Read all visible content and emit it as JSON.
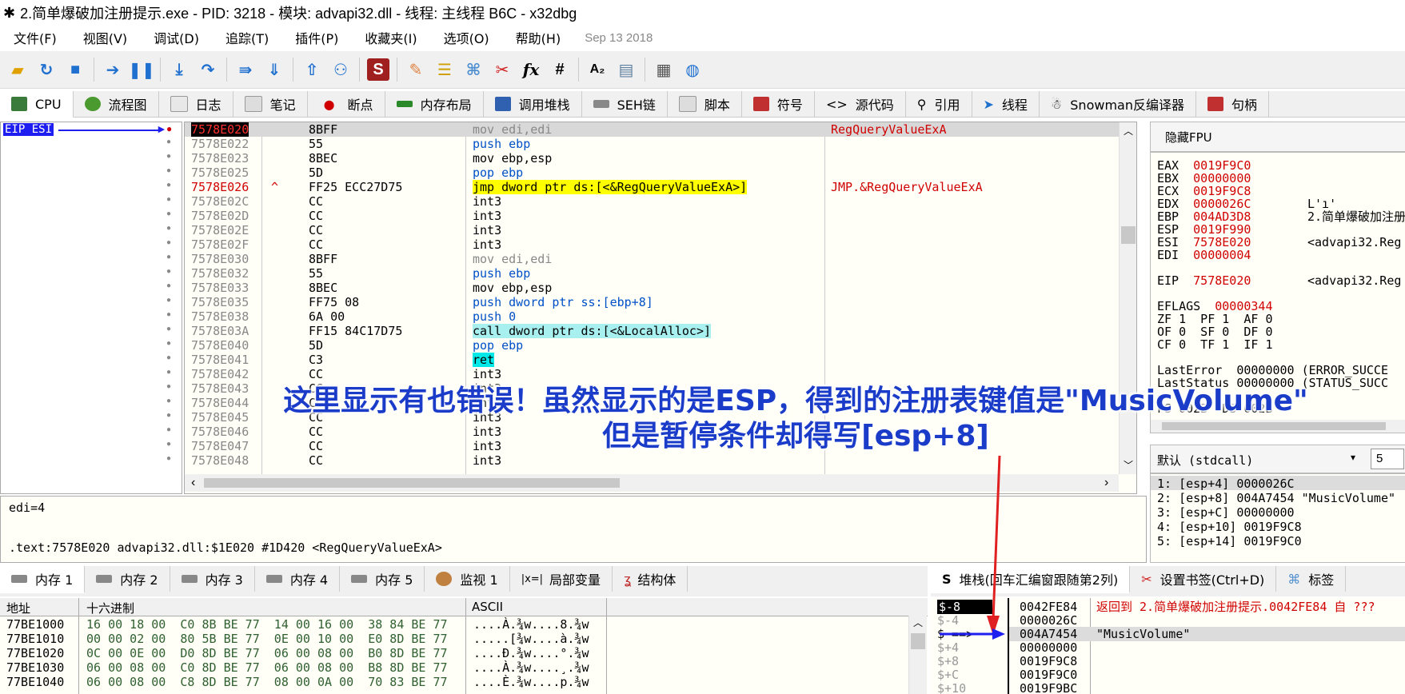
{
  "window": {
    "title": "2.简单爆破加注册提示.exe - PID: 3218 - 模块: advapi32.dll - 线程: 主线程 B6C - x32dbg"
  },
  "menu": {
    "items": [
      "文件(F)",
      "视图(V)",
      "调试(D)",
      "追踪(T)",
      "插件(P)",
      "收藏夹(I)",
      "选项(O)",
      "帮助(H)"
    ],
    "date": "Sep 13 2018"
  },
  "toolbar": {
    "fx_label": "fx",
    "hash_label": "#",
    "az_label": "A₂"
  },
  "tabs": [
    {
      "label": "CPU"
    },
    {
      "label": "流程图"
    },
    {
      "label": "日志"
    },
    {
      "label": "笔记"
    },
    {
      "label": "断点"
    },
    {
      "label": "内存布局"
    },
    {
      "label": "调用堆栈"
    },
    {
      "label": "SEH链"
    },
    {
      "label": "脚本"
    },
    {
      "label": "符号"
    },
    {
      "label": "源代码"
    },
    {
      "label": "引用"
    },
    {
      "label": "线程"
    },
    {
      "label": "Snowman反编译器"
    },
    {
      "label": "句柄"
    }
  ],
  "gutter": {
    "label": "EIP ESI"
  },
  "disasm": {
    "rows": [
      {
        "addr": "7578E020",
        "bytes": "8BFF",
        "ins": "mov edi,edi",
        "cmt": "RegQueryValueExA"
      },
      {
        "addr": "7578E022",
        "bytes": "55",
        "ins": "push ebp",
        "cmt": ""
      },
      {
        "addr": "7578E023",
        "bytes": "8BEC",
        "ins": "mov ebp,esp",
        "cmt": ""
      },
      {
        "addr": "7578E025",
        "bytes": "5D",
        "ins": "pop ebp",
        "cmt": ""
      },
      {
        "addr": "7578E026",
        "bytes": "FF25 ECC27D75",
        "ins": "jmp dword ptr ds:[<&RegQueryValueExA>]",
        "cmt": "JMP.&RegQueryValueExA"
      },
      {
        "addr": "7578E02C",
        "bytes": "CC",
        "ins": "int3",
        "cmt": ""
      },
      {
        "addr": "7578E02D",
        "bytes": "CC",
        "ins": "int3",
        "cmt": ""
      },
      {
        "addr": "7578E02E",
        "bytes": "CC",
        "ins": "int3",
        "cmt": ""
      },
      {
        "addr": "7578E02F",
        "bytes": "CC",
        "ins": "int3",
        "cmt": ""
      },
      {
        "addr": "7578E030",
        "bytes": "8BFF",
        "ins": "mov edi,edi",
        "cmt": ""
      },
      {
        "addr": "7578E032",
        "bytes": "55",
        "ins": "push ebp",
        "cmt": ""
      },
      {
        "addr": "7578E033",
        "bytes": "8BEC",
        "ins": "mov ebp,esp",
        "cmt": ""
      },
      {
        "addr": "7578E035",
        "bytes": "FF75 08",
        "ins": "push dword ptr ss:[ebp+8]",
        "cmt": ""
      },
      {
        "addr": "7578E038",
        "bytes": "6A 00",
        "ins": "push 0",
        "cmt": ""
      },
      {
        "addr": "7578E03A",
        "bytes": "FF15 84C17D75",
        "ins": "call dword ptr ds:[<&LocalAlloc>]",
        "cmt": ""
      },
      {
        "addr": "7578E040",
        "bytes": "5D",
        "ins": "pop ebp",
        "cmt": ""
      },
      {
        "addr": "7578E041",
        "bytes": "C3",
        "ins": "ret",
        "cmt": ""
      },
      {
        "addr": "7578E042",
        "bytes": "CC",
        "ins": "int3",
        "cmt": ""
      },
      {
        "addr": "7578E043",
        "bytes": "CC",
        "ins": "int3",
        "cmt": ""
      },
      {
        "addr": "7578E044",
        "bytes": "CC",
        "ins": "int3",
        "cmt": ""
      },
      {
        "addr": "7578E045",
        "bytes": "CC",
        "ins": "int3",
        "cmt": ""
      },
      {
        "addr": "7578E046",
        "bytes": "CC",
        "ins": "int3",
        "cmt": ""
      },
      {
        "addr": "7578E047",
        "bytes": "CC",
        "ins": "int3",
        "cmt": ""
      },
      {
        "addr": "7578E048",
        "bytes": "CC",
        "ins": "int3",
        "cmt": ""
      }
    ]
  },
  "registers": {
    "header": "隐藏FPU",
    "EAX": "0019F9C0",
    "EBX": "00000000",
    "ECX": "0019F9C8",
    "EDX": "0000026C",
    "EBP": "004AD3D8",
    "ESP": "0019F990",
    "ESI": "7578E020",
    "EDI": "00000004",
    "EIP": "7578E020",
    "EDX_cmt": "L'ı'",
    "EBP_cmt": "2.简单爆破加注册",
    "ESI_cmt": "<advapi32.Reg",
    "EIP_cmt": "<advapi32.Reg",
    "EFLAGS": "00000344",
    "flags1": "ZF 1  PF 1  AF 0",
    "flags2": "OF 0  SF 0  DF 0",
    "flags3": "CF 0  TF 1  IF 1",
    "lasterror": "LastError  00000000 (ERROR_SUCCE",
    "laststatus": "LastStatus 00000000 (STATUS_SUCC",
    "segs": "FS 002B  DS 002B"
  },
  "callconv": {
    "label": "默认 (stdcall)",
    "count": "5"
  },
  "args": [
    "1: [esp+4] 0000026C",
    "2: [esp+8] 004A7454 \"MusicVolume\"",
    "3: [esp+C] 00000000",
    "4: [esp+10] 0019F9C8",
    "5: [esp+14] 0019F9C0"
  ],
  "info": {
    "line1": "edi=4",
    "line2": ".text:7578E020 advapi32.dll:$1E020 #1D420 <RegQueryValueExA>"
  },
  "memtabs": [
    "内存 1",
    "内存 2",
    "内存 3",
    "内存 4",
    "内存 5",
    "监视 1",
    "局部变量",
    "结构体"
  ],
  "stacktabs": [
    "堆栈(回车汇编窗跟随第2列)",
    "设置书签(Ctrl+D)",
    "标签"
  ],
  "dump": {
    "headers": [
      "地址",
      "十六进制",
      "ASCII"
    ],
    "rows": [
      {
        "addr": "77BE1000",
        "hex": "16 00 18 00  C0 8B BE 77  14 00 16 00  38 84 BE 77",
        "ascii": "....À.¾w....8.¾w"
      },
      {
        "addr": "77BE1010",
        "hex": "00 00 02 00  80 5B BE 77  0E 00 10 00  E0 8D BE 77",
        "ascii": ".....[¾w....à.¾w"
      },
      {
        "addr": "77BE1020",
        "hex": "0C 00 0E 00  D0 8D BE 77  06 00 08 00  B0 8D BE 77",
        "ascii": "....Ð.¾w....°.¾w"
      },
      {
        "addr": "77BE1030",
        "hex": "06 00 08 00  C0 8D BE 77  06 00 08 00  B8 8D BE 77",
        "ascii": "....À.¾w....¸.¾w"
      },
      {
        "addr": "77BE1040",
        "hex": "06 00 08 00  C8 8D BE 77  08 00 0A 00  70 83 BE 77",
        "ascii": "....È.¾w....p.¾w"
      }
    ]
  },
  "stack": {
    "offsets": [
      "$-8",
      "$-4",
      "$ ==>",
      "$+4",
      "$+8",
      "$+C",
      "$+10"
    ],
    "addrs": [
      "0042FE84",
      "0000026C",
      "004A7454",
      "00000000",
      "0019F9C8",
      "0019F9C0",
      "0019F9BC"
    ],
    "comments": [
      "返回到 2.简单爆破加注册提示.0042FE84 自 ???",
      "",
      "\"MusicVolume\"",
      "",
      "",
      "",
      ""
    ]
  },
  "annotation": {
    "line1": "这里显示有也错误！虽然显示的是ESP，得到的注册表键值是\"MusicVolume\"",
    "line2": "但是暂停条件却得写[esp+8]"
  },
  "colors": {
    "accent_blue": "#1a3cc8",
    "eip_bg": "#1e1ef0",
    "red_addr": "#d00000"
  }
}
